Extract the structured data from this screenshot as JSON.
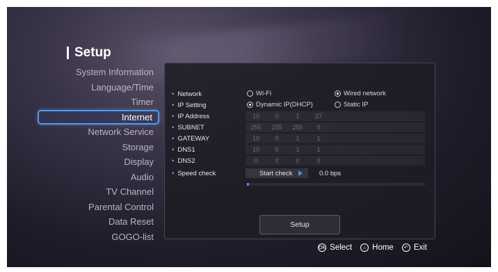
{
  "title": "Setup",
  "menu": [
    {
      "label": "System Information"
    },
    {
      "label": "Language/Time"
    },
    {
      "label": "Timer"
    },
    {
      "label": "Internet",
      "active": true
    },
    {
      "label": "Network Service"
    },
    {
      "label": "Storage"
    },
    {
      "label": "Display"
    },
    {
      "label": "Audio"
    },
    {
      "label": "TV Channel"
    },
    {
      "label": "Parental Control"
    },
    {
      "label": "Data Reset"
    },
    {
      "label": "GOGO-list"
    }
  ],
  "settings": {
    "network": {
      "label": "Network",
      "options": [
        "Wi-Fi",
        "Wired network"
      ],
      "selected": "Wired network"
    },
    "ip_setting": {
      "label": "IP Setting",
      "options": [
        "Dynamic IP(DHCP)",
        "Static IP"
      ],
      "selected": "Dynamic IP(DHCP)"
    },
    "ip_address": {
      "label": "IP Address",
      "octets": [
        "10",
        "0",
        "1",
        "27"
      ]
    },
    "subnet": {
      "label": "SUBNET",
      "octets": [
        "255",
        "255",
        "255",
        "0"
      ]
    },
    "gateway": {
      "label": "GATEWAY",
      "octets": [
        "10",
        "0",
        "1",
        "1"
      ]
    },
    "dns1": {
      "label": "DNS1",
      "octets": [
        "10",
        "0",
        "1",
        "1"
      ]
    },
    "dns2": {
      "label": "DNS2",
      "octets": [
        "0",
        "0",
        "0",
        "0"
      ]
    },
    "speed_check": {
      "label": "Speed check",
      "button": "Start check",
      "speed": "0.0 bps",
      "progress": 0.01
    }
  },
  "setup_button": "Setup",
  "footer": {
    "select": {
      "label": "Select",
      "icon_glyph": "OK"
    },
    "home": {
      "label": "Home",
      "icon_glyph": "⌂"
    },
    "exit": {
      "label": "Exit",
      "icon_glyph": "↶"
    }
  },
  "colors": {
    "accent": "#4a90e6",
    "highlight_border": "#5a9ae0"
  }
}
